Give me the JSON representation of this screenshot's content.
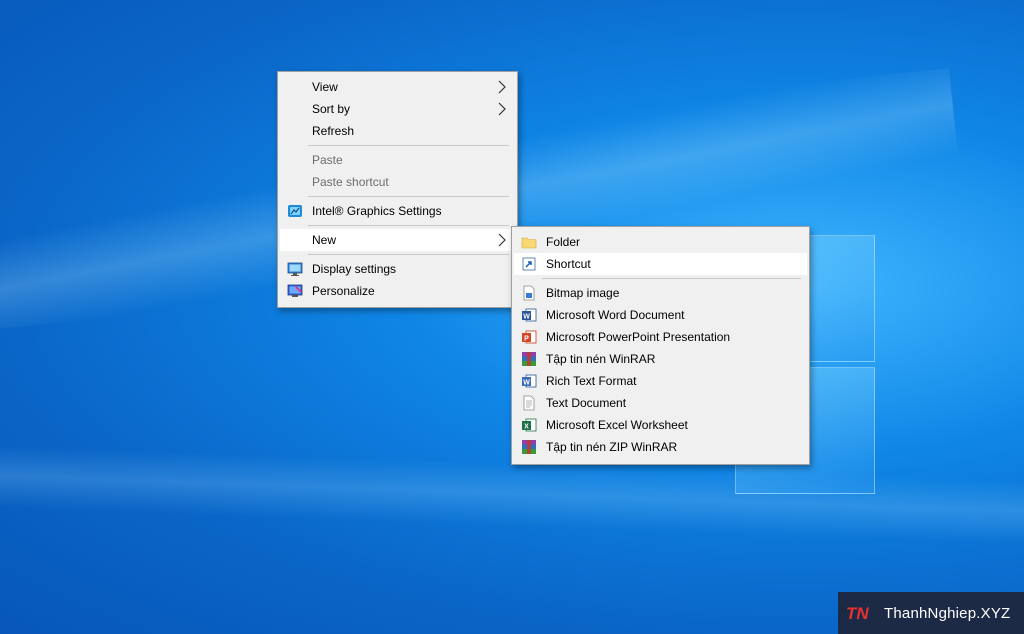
{
  "desktop": {
    "main_menu": {
      "view": "View",
      "sort_by": "Sort by",
      "refresh": "Refresh",
      "paste": "Paste",
      "paste_shortcut": "Paste shortcut",
      "intel_graphics": "Intel® Graphics Settings",
      "new": "New",
      "display_settings": "Display settings",
      "personalize": "Personalize"
    },
    "new_submenu": {
      "folder": "Folder",
      "shortcut": "Shortcut",
      "bitmap": "Bitmap image",
      "word": "Microsoft Word Document",
      "powerpoint": "Microsoft PowerPoint Presentation",
      "winrar": "Tập tin nén WinRAR",
      "rtf": "Rich Text Format",
      "text": "Text Document",
      "excel": "Microsoft Excel Worksheet",
      "winrar_zip": "Tập tin nén ZIP WinRAR"
    }
  },
  "watermark": {
    "logo": "TN",
    "text": "ThanhNghiep.XYZ"
  },
  "colors": {
    "desktop_blue": "#0f86e6",
    "menu_bg": "#f0f0f0",
    "hover_bg": "#ffffff",
    "disabled_text": "#6d6d6d",
    "watermark_bg": "#1c2a45",
    "watermark_accent": "#e8312f"
  }
}
